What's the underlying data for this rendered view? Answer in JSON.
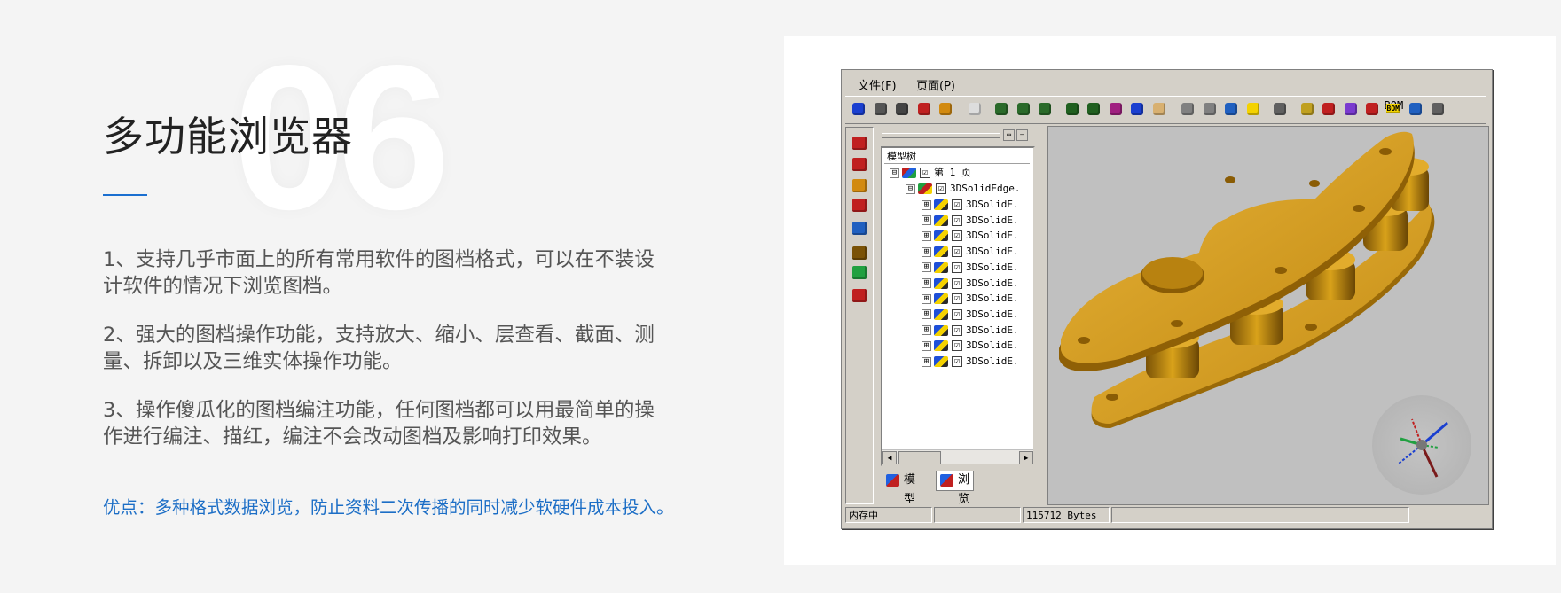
{
  "section_number": "06",
  "title": "多功能浏览器",
  "paragraphs": [
    "1、支持几乎市面上的所有常用软件的图档格式，可以在不装设计软件的情况下浏览图档。",
    "2、强大的图档操作功能，支持放大、缩小、层查看、截面、测量、拆卸以及三维实体操作功能。",
    "3、操作傻瓜化的图档编注功能，任何图档都可以用最简单的操作进行编注、描红，编注不会改动图档及影响打印效果。"
  ],
  "advantage": "优点：多种格式数据浏览，防止资料二次传播的同时减少软硬件成本投入。",
  "colors": {
    "accent": "#1a6fd0",
    "advantage_text": "#1c6ec6",
    "model_gold": "#d9a21a"
  },
  "app": {
    "menu": [
      "文件(F)",
      "页面(P)"
    ],
    "toolbar_icons": [
      "info-icon",
      "preview-icon",
      "print-icon",
      "markup-icon",
      "export-icon",
      "select-arrow-icon",
      "zoom-in-icon",
      "zoom-out-icon",
      "fit-icon",
      "zoom-window-icon",
      "zoom-dynamic-icon",
      "zoom-region-icon",
      "rotate-icon",
      "pan-hand-icon",
      "layer-icon",
      "measure-icon",
      "section-icon",
      "light-bulb-icon",
      "properties-icon",
      "assembly-icon",
      "explode-icon",
      "orbit-icon",
      "parts-icon",
      "bom-icon",
      "report-icon",
      "table-icon"
    ],
    "bom_label": "BOM",
    "left_tools": [
      "dimension-icon",
      "annotation-icon",
      "mark-icon",
      "cloud-icon",
      "distance-icon",
      "angle-icon",
      "area-icon",
      "3d-box-icon"
    ],
    "panel": {
      "tree_header": "模型树",
      "root_label": "第 1 页",
      "root_expander": "⊟",
      "assembly_label": "3DSolidEdge.",
      "children_label": "3DSolidE.",
      "child_expander": "⊞",
      "check": "☑",
      "children_count": 11,
      "tabs": [
        "模型",
        "浏览"
      ],
      "active_tab": 1
    },
    "status": [
      "内存中",
      "",
      "115712 Bytes",
      ""
    ]
  }
}
